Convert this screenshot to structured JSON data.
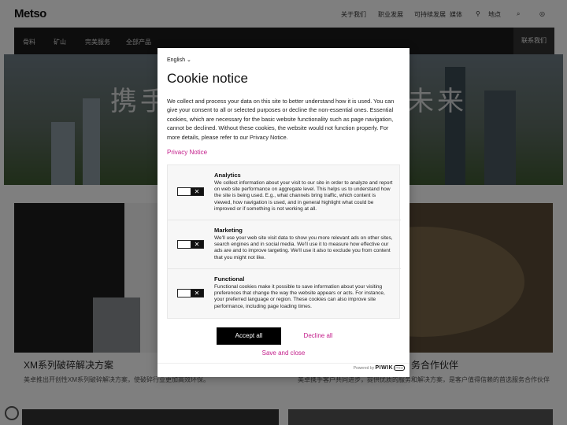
{
  "background_page": {
    "logo": "Metso",
    "top_nav": [
      "关于我们",
      "职业发展",
      "可持续发展",
      "媒体",
      "地点"
    ],
    "main_nav": [
      "骨料",
      "矿山",
      "完美服务",
      "全部产品"
    ],
    "contact_button": "联系我们",
    "hero_title_left": "携手",
    "hero_title_right": "未来",
    "cards": [
      {
        "title": "XM系列破碎解决方案",
        "desc": "美卓推出开创性XM系列破碎解决方案，使破碎行业更加高效环保。"
      },
      {
        "title": "务合作伙伴",
        "desc": "美卓携手客户共同进步，提供优质的服务和解决方案，是客户值得信赖的首选服务合作伙伴"
      }
    ]
  },
  "cookie_modal": {
    "language": "English",
    "title": "Cookie notice",
    "body": "We collect and process your data on this site to better understand how it is used. You can give your consent to all or selected purposes or decline the non-essential ones. Essential cookies, which are necessary for the basic website functionality such as page navigation, cannot be declined. Without these cookies, the website would not function properly. For more details, please refer to our Privacy Notice.",
    "privacy_link": "Privacy Notice",
    "sections": [
      {
        "title": "Analytics",
        "desc": "We collect information about your visit to our site in order to analyze and report on web site performance on aggregate level. This helps us to understand how the site is being used. E.g., what channels bring traffic, which content is viewed, how navigation is used, and in general highlight what could be improved or if something is not working at all.",
        "enabled": false
      },
      {
        "title": "Marketing",
        "desc": "We'll use your web site visit data to show you more relevant ads on other sites, search engines and in social media. We'll use it to measure how effective our ads are and to improve targeting. We'll use it also to exclude you from content that you might not like.",
        "enabled": false
      },
      {
        "title": "Functional",
        "desc": "Functional cookies make it possible to save information about your visiting preferences that change the way the website appears or acts. For instance, your preferred language or region. These cookies can also improve site performance, including page loading times.",
        "enabled": false
      }
    ],
    "toggle_off_glyph": "✕",
    "accept_label": "Accept all",
    "decline_label": "Decline all",
    "save_label": "Save and close",
    "powered_by": "Powered by",
    "brand": "PIWIK",
    "brand_badge": "PRO"
  },
  "colors": {
    "accent": "#c4208c",
    "button_dark": "#000000",
    "overlay": "rgba(0,0,0,0.5)"
  }
}
